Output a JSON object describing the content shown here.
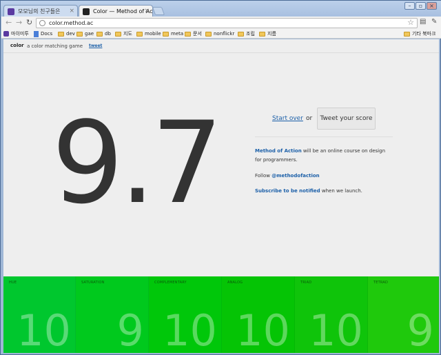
{
  "browser": {
    "tabs": [
      {
        "title": "모모님의 친구들은",
        "active": false
      },
      {
        "title": "Color — Method of Action",
        "active": true
      }
    ],
    "url": "color.method.ac",
    "bookmarks": [
      {
        "label": "마이미투",
        "icon": "purple"
      },
      {
        "label": "Docs",
        "icon": "doc"
      },
      {
        "label": "dev",
        "icon": "folder"
      },
      {
        "label": "gae",
        "icon": "folder"
      },
      {
        "label": "db",
        "icon": "folder"
      },
      {
        "label": "지도",
        "icon": "folder"
      },
      {
        "label": "mobile",
        "icon": "folder"
      },
      {
        "label": "meta",
        "icon": "folder"
      },
      {
        "label": "문서",
        "icon": "folder"
      },
      {
        "label": "nonflickr",
        "icon": "folder"
      },
      {
        "label": "조립",
        "icon": "folder"
      },
      {
        "label": "지름",
        "icon": "folder"
      }
    ],
    "other_bookmarks": "기타 북마크"
  },
  "header": {
    "brand": "color",
    "tagline": "a color matching game",
    "tweet_link": "tweet"
  },
  "result": {
    "score": "9.7",
    "start_over": "Start over",
    "or": "or",
    "tweet_button": "Tweet your score"
  },
  "info": {
    "course_link": "Method of Action",
    "course_text": " will be an online course on design for programmers.",
    "follow_prefix": "Follow ",
    "follow_handle": "@methodofaction",
    "subscribe_link": "Subscribe to be notified",
    "subscribe_text": " when we launch."
  },
  "scores": [
    {
      "label": "HUE",
      "score": "10",
      "color": "#00c72e"
    },
    {
      "label": "SATURATION",
      "score": "9",
      "color": "#00c91d"
    },
    {
      "label": "COMPLEMENTARY",
      "score": "10",
      "color": "#00c70a"
    },
    {
      "label": "ANALOG",
      "score": "10",
      "color": "#05c405"
    },
    {
      "label": "TRIAD",
      "score": "10",
      "color": "#0fc40a"
    },
    {
      "label": "TETRAD",
      "score": "9",
      "color": "#1fc90c"
    }
  ]
}
